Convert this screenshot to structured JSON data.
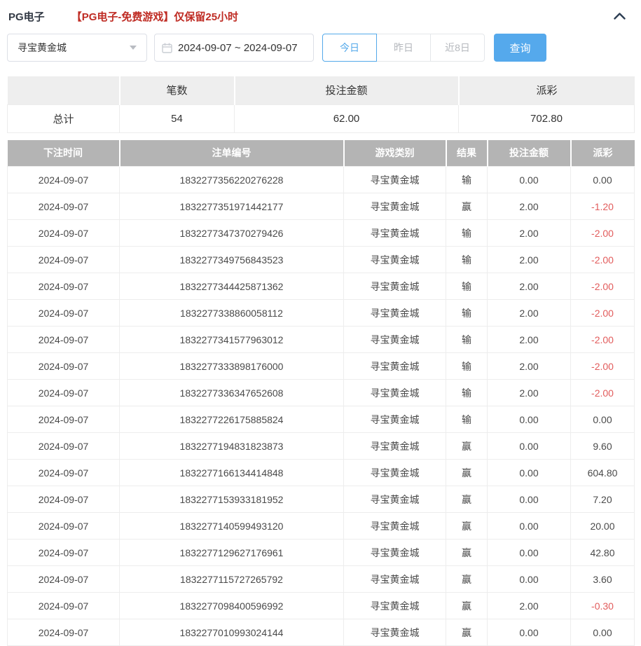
{
  "header": {
    "title": "PG电子",
    "notice": "【PG电子-免费游戏】仅保留25小时"
  },
  "filters": {
    "game_select": {
      "value": "寻宝黄金城"
    },
    "date_range": {
      "value": "2024-09-07 ~ 2024-09-07"
    },
    "quick_buttons": [
      {
        "label": "今日",
        "active": true
      },
      {
        "label": "昨日",
        "active": false
      },
      {
        "label": "近8日",
        "active": false
      }
    ],
    "search_label": "查询"
  },
  "summary": {
    "headers": [
      "",
      "笔数",
      "投注金额",
      "派彩"
    ],
    "row_label": "总计",
    "count": "54",
    "bet_amount": "62.00",
    "payout": "702.80"
  },
  "table": {
    "headers": [
      "下注时间",
      "注单编号",
      "游戏类别",
      "结果",
      "投注金额",
      "派彩"
    ],
    "rows": [
      {
        "date": "2024-09-07",
        "order_id": "1832277356220276228",
        "game": "寻宝黄金城",
        "result": "输",
        "amount": "0.00",
        "payout": "0.00"
      },
      {
        "date": "2024-09-07",
        "order_id": "1832277351971442177",
        "game": "寻宝黄金城",
        "result": "赢",
        "amount": "2.00",
        "payout": "-1.20"
      },
      {
        "date": "2024-09-07",
        "order_id": "1832277347370279426",
        "game": "寻宝黄金城",
        "result": "输",
        "amount": "2.00",
        "payout": "-2.00"
      },
      {
        "date": "2024-09-07",
        "order_id": "1832277349756843523",
        "game": "寻宝黄金城",
        "result": "输",
        "amount": "2.00",
        "payout": "-2.00"
      },
      {
        "date": "2024-09-07",
        "order_id": "1832277344425871362",
        "game": "寻宝黄金城",
        "result": "输",
        "amount": "2.00",
        "payout": "-2.00"
      },
      {
        "date": "2024-09-07",
        "order_id": "1832277338860058112",
        "game": "寻宝黄金城",
        "result": "输",
        "amount": "2.00",
        "payout": "-2.00"
      },
      {
        "date": "2024-09-07",
        "order_id": "1832277341577963012",
        "game": "寻宝黄金城",
        "result": "输",
        "amount": "2.00",
        "payout": "-2.00"
      },
      {
        "date": "2024-09-07",
        "order_id": "1832277333898176000",
        "game": "寻宝黄金城",
        "result": "输",
        "amount": "2.00",
        "payout": "-2.00"
      },
      {
        "date": "2024-09-07",
        "order_id": "1832277336347652608",
        "game": "寻宝黄金城",
        "result": "输",
        "amount": "2.00",
        "payout": "-2.00"
      },
      {
        "date": "2024-09-07",
        "order_id": "1832277226175885824",
        "game": "寻宝黄金城",
        "result": "输",
        "amount": "0.00",
        "payout": "0.00"
      },
      {
        "date": "2024-09-07",
        "order_id": "1832277194831823873",
        "game": "寻宝黄金城",
        "result": "赢",
        "amount": "0.00",
        "payout": "9.60"
      },
      {
        "date": "2024-09-07",
        "order_id": "1832277166134414848",
        "game": "寻宝黄金城",
        "result": "赢",
        "amount": "0.00",
        "payout": "604.80"
      },
      {
        "date": "2024-09-07",
        "order_id": "1832277153933181952",
        "game": "寻宝黄金城",
        "result": "赢",
        "amount": "0.00",
        "payout": "7.20"
      },
      {
        "date": "2024-09-07",
        "order_id": "1832277140599493120",
        "game": "寻宝黄金城",
        "result": "赢",
        "amount": "0.00",
        "payout": "20.00"
      },
      {
        "date": "2024-09-07",
        "order_id": "1832277129627176961",
        "game": "寻宝黄金城",
        "result": "赢",
        "amount": "0.00",
        "payout": "42.80"
      },
      {
        "date": "2024-09-07",
        "order_id": "1832277115727265792",
        "game": "寻宝黄金城",
        "result": "赢",
        "amount": "0.00",
        "payout": "3.60"
      },
      {
        "date": "2024-09-07",
        "order_id": "1832277098400596992",
        "game": "寻宝黄金城",
        "result": "赢",
        "amount": "2.00",
        "payout": "-0.30"
      },
      {
        "date": "2024-09-07",
        "order_id": "1832277010993024144",
        "game": "寻宝黄金城",
        "result": "赢",
        "amount": "0.00",
        "payout": "0.00"
      }
    ]
  },
  "colors": {
    "accent_blue": "#55a9ec",
    "negative_red": "#e25c5c",
    "table_header_gray": "#b4b4b4",
    "notice_red": "#bf2c24"
  }
}
